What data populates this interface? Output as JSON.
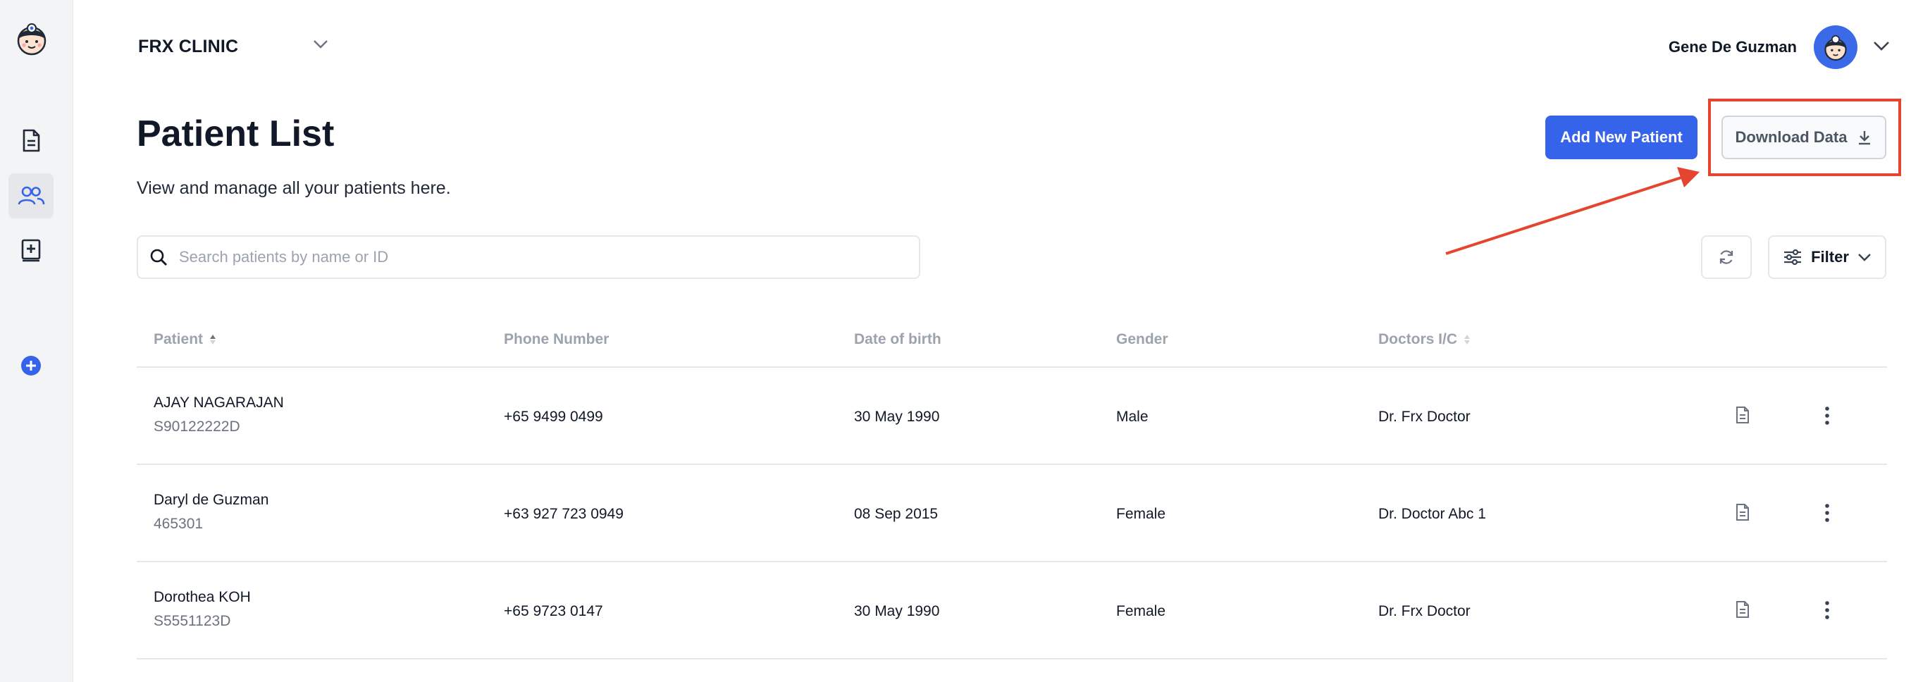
{
  "clinic": {
    "name": "FRX CLINIC"
  },
  "user": {
    "name": "Gene De Guzman"
  },
  "page": {
    "title": "Patient List",
    "subtitle": "View and manage all your patients here."
  },
  "actions": {
    "add_patient": "Add New Patient",
    "download": "Download Data",
    "filter": "Filter"
  },
  "search": {
    "placeholder": "Search patients by name or ID",
    "value": ""
  },
  "table": {
    "columns": [
      "Patient",
      "Phone Number",
      "Date of birth",
      "Gender",
      "Doctors I/C"
    ],
    "rows": [
      {
        "name": "AJAY NAGARAJAN",
        "id": "S90122222D",
        "phone": "+65 9499 0499",
        "dob": "30 May 1990",
        "gender": "Male",
        "doctor": "Dr. Frx Doctor"
      },
      {
        "name": "Daryl de Guzman",
        "id": "465301",
        "phone": "+63 927 723 0949",
        "dob": "08 Sep 2015",
        "gender": "Female",
        "doctor": "Dr. Doctor Abc 1"
      },
      {
        "name": "Dorothea KOH",
        "id": "S5551123D",
        "phone": "+65 9723 0147",
        "dob": "30 May 1990",
        "gender": "Female",
        "doctor": "Dr. Frx Doctor"
      }
    ]
  },
  "colors": {
    "accent": "#3563e9",
    "annotation": "#e5452f",
    "sidebar_bg": "#f3f4f6"
  },
  "icons": [
    "doctor-logo-icon",
    "document-icon",
    "users-icon",
    "medical-book-icon",
    "add-circle-icon",
    "chevron-down-icon",
    "download-icon",
    "search-icon",
    "refresh-icon",
    "sliders-icon",
    "sort-icon",
    "more-vertical-icon"
  ]
}
